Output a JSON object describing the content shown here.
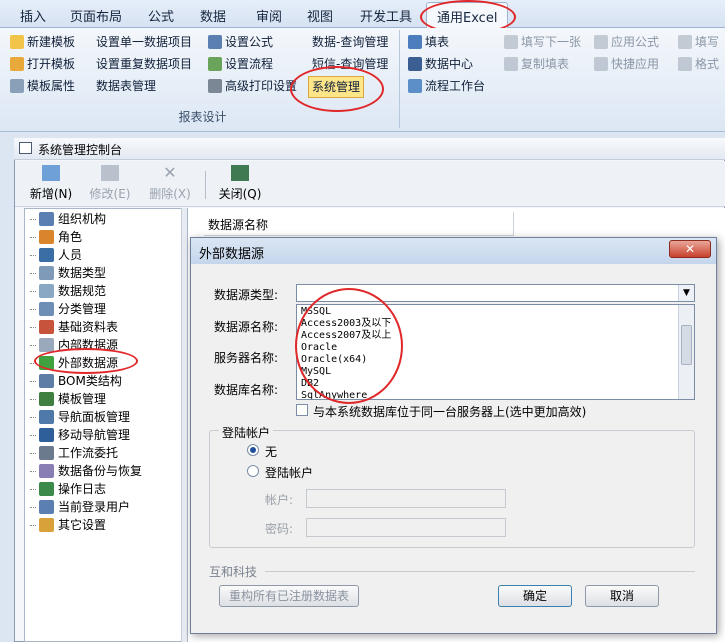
{
  "ribbon_tabs": [
    "插入",
    "页面布局",
    "公式",
    "数据",
    "审阅",
    "视图",
    "开发工具",
    "通用Excel"
  ],
  "report_group": {
    "label": "报表设计",
    "col1": [
      "新建模板",
      "打开模板",
      "模板属性"
    ],
    "col2": [
      "设置单一数据项目",
      "设置重复数据项目",
      "数据表管理"
    ],
    "col3": [
      "设置公式",
      "设置流程",
      "高级打印设置"
    ],
    "col4": [
      "数据-查询管理",
      "短信-查询管理",
      "系统管理"
    ]
  },
  "other_group": {
    "col1": [
      "填表",
      "数据中心",
      "流程工作台"
    ],
    "col2": [
      "填写下一张",
      "复制填表"
    ],
    "col3": [
      "应用公式",
      "快捷应用"
    ],
    "col4": [
      "填写",
      "格式"
    ]
  },
  "console": {
    "title": "系统管理控制台",
    "toolbar": [
      {
        "label": "新增(N)",
        "enabled": true
      },
      {
        "label": "修改(E)",
        "enabled": false
      },
      {
        "label": "删除(X)",
        "enabled": false
      },
      {
        "label": "关闭(Q)",
        "enabled": true
      }
    ],
    "tree": [
      "组织机构",
      "角色",
      "人员",
      "数据类型",
      "数据规范",
      "分类管理",
      "基础资料表",
      "内部数据源",
      "外部数据源",
      "BOM类结构",
      "模板管理",
      "导航面板管理",
      "移动导航管理",
      "工作流委托",
      "数据备份与恢复",
      "操作日志",
      "当前登录用户",
      "其它设置"
    ],
    "grid_header": "数据源名称"
  },
  "dialog": {
    "title": "外部数据源",
    "close": "✕",
    "fields": {
      "source_type": "数据源类型:",
      "source_name": "数据源名称:",
      "server_name": "服务器名称:",
      "db_name": "数据库名称:"
    },
    "type_options": [
      "MSSQL",
      "Access2003及以下",
      "Access2007及以上",
      "Oracle",
      "Oracle(x64)",
      "MySQL",
      "DB2",
      "SqlAnywhere"
    ],
    "same_server": "与本系统数据库位于同一台服务器上(选中更加高效)",
    "login_group": {
      "legend": "登陆帐户",
      "none": "无",
      "account": "登陆帐户",
      "user_label": "帐户:",
      "pwd_label": "密码:"
    },
    "company": "互和科技",
    "rebuild": "重构所有已注册数据表",
    "ok": "确定",
    "cancel": "取消"
  }
}
